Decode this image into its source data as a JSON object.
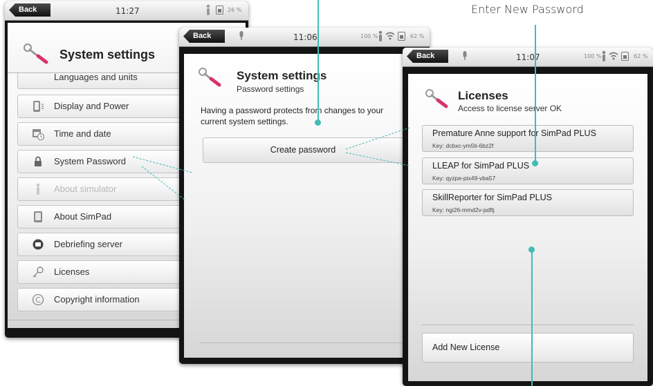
{
  "screens": {
    "settings": {
      "status": {
        "back": "Back",
        "time": "11:27",
        "battery": "26 %"
      },
      "title": "System settings",
      "items": [
        {
          "label": "Languages and units"
        },
        {
          "label": "Display and Power"
        },
        {
          "label": "Time and date"
        },
        {
          "label": "System Password"
        },
        {
          "label": "About simulator"
        },
        {
          "label": "About SimPad"
        },
        {
          "label": "Debriefing server"
        },
        {
          "label": "Licenses"
        },
        {
          "label": "Copyright information"
        }
      ]
    },
    "password": {
      "status": {
        "back": "Back",
        "time": "11:06",
        "battery_left": "100 %",
        "battery_right": "62 %"
      },
      "title": "System settings",
      "subtitle": "Password settings",
      "description": "Having a password protects from changes to your current system settings.",
      "create_button": "Create password"
    },
    "licenses": {
      "status": {
        "back": "Back",
        "time": "11:07",
        "battery_left": "100 %",
        "battery_right": "62 %"
      },
      "title": "Licenses",
      "subtitle": "Access to license server OK",
      "items": [
        {
          "name": "Premature Anne support for SimPad PLUS",
          "key": "Key: dcbxc-ym5ti-6bz2f"
        },
        {
          "name": "LLEAP for SimPad PLUS",
          "key": "Key: qyzpe-pix49-vba57"
        },
        {
          "name": "SkillReporter for SimPad PLUS",
          "key": "Key: ngi26-mmd2v-pdftj"
        }
      ],
      "add_button": "Add New License"
    }
  },
  "annotations": {
    "enter_new_password": "Enter New Password"
  },
  "colors": {
    "accent": "#40bcb5",
    "background": "#ffffff",
    "device": "#141414"
  },
  "icons": [
    "tools-icon",
    "globe-icon",
    "display-icon",
    "calendar-clock-icon",
    "lock-icon",
    "person-icon",
    "simpad-icon",
    "server-icon",
    "key-icon",
    "copyright-icon",
    "battery-icon",
    "wifi-icon",
    "microphone-icon"
  ]
}
